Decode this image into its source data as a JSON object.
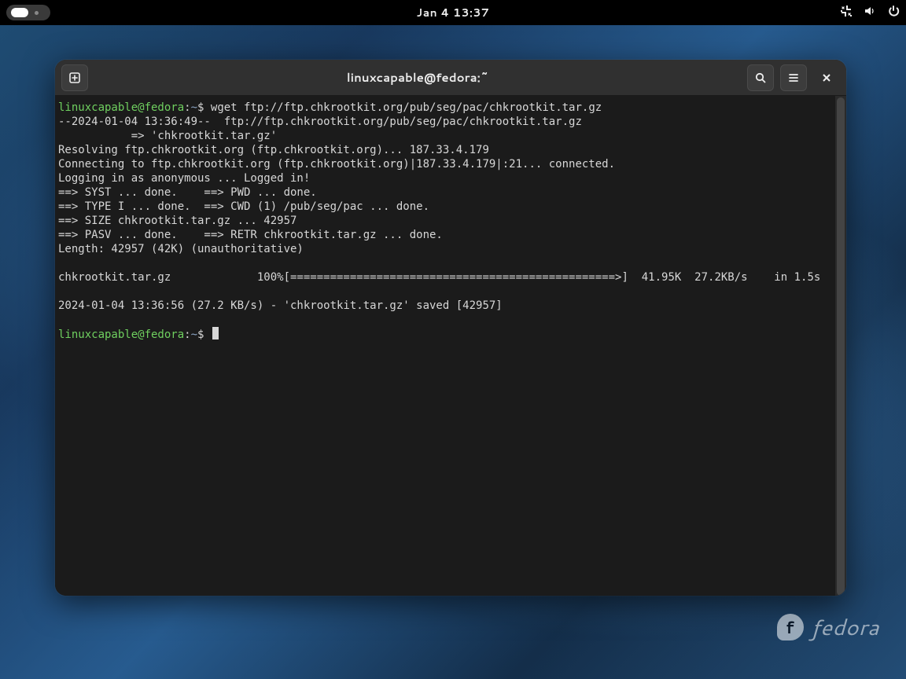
{
  "topbar": {
    "clock": "Jan 4  13:37"
  },
  "window": {
    "title": "linuxcapable@fedora:~"
  },
  "prompt": {
    "user": "linuxcapable@fedora",
    "sep1": ":",
    "path": "~",
    "sigil": "$"
  },
  "terminal": {
    "cmd1": " wget ftp://ftp.chkrootkit.org/pub/seg/pac/chkrootkit.tar.gz",
    "line2": "--2024-01-04 13:36:49--  ftp://ftp.chkrootkit.org/pub/seg/pac/chkrootkit.tar.gz",
    "line3": "           => 'chkrootkit.tar.gz'",
    "line4": "Resolving ftp.chkrootkit.org (ftp.chkrootkit.org)... 187.33.4.179",
    "line5": "Connecting to ftp.chkrootkit.org (ftp.chkrootkit.org)|187.33.4.179|:21... connected.",
    "line6": "Logging in as anonymous ... Logged in!",
    "line7": "==> SYST ... done.    ==> PWD ... done.",
    "line8": "==> TYPE I ... done.  ==> CWD (1) /pub/seg/pac ... done.",
    "line9": "==> SIZE chkrootkit.tar.gz ... 42957",
    "line10": "==> PASV ... done.    ==> RETR chkrootkit.tar.gz ... done.",
    "line11": "Length: 42957 (42K) (unauthoritative)",
    "blank": "",
    "line12": "chkrootkit.tar.gz             100%[=================================================>]  41.95K  27.2KB/s    in 1.5s",
    "line13": "2024-01-04 13:36:56 (27.2 KB/s) - 'chkrootkit.tar.gz' saved [42957]"
  },
  "watermark": {
    "text": "fedora",
    "glyph": "f"
  }
}
